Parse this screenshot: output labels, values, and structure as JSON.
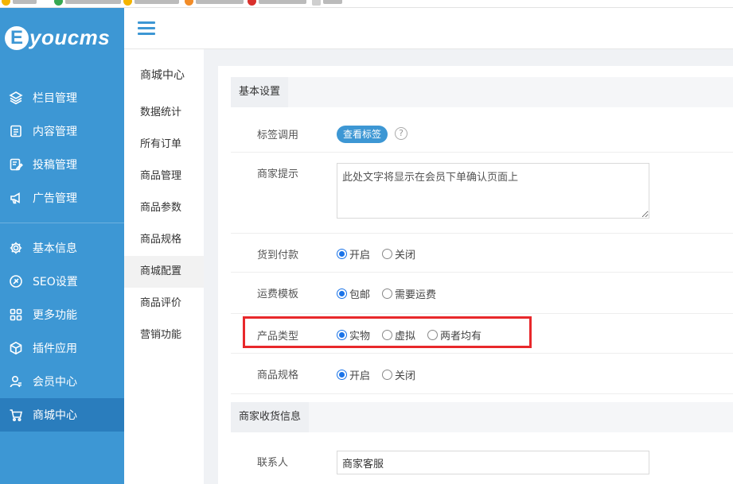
{
  "colors": {
    "sidebar_bg": "#3d97d4",
    "sidebar_active": "#2a7dbd",
    "accent": "#3d97d4",
    "radio_on": "#1a73e8",
    "highlight": "#e8282b"
  },
  "brand": {
    "logo_letter": "E",
    "logo_text": "youcms"
  },
  "sidebar": {
    "items": [
      {
        "label": "栏目管理",
        "icon": "layers-icon"
      },
      {
        "label": "内容管理",
        "icon": "document-icon"
      },
      {
        "label": "投稿管理",
        "icon": "edit-icon"
      },
      {
        "label": "广告管理",
        "icon": "megaphone-icon"
      },
      {
        "label": "基本信息",
        "icon": "gear-icon"
      },
      {
        "label": "SEO设置",
        "icon": "seo-icon"
      },
      {
        "label": "更多功能",
        "icon": "grid-icon"
      },
      {
        "label": "插件应用",
        "icon": "cube-icon"
      },
      {
        "label": "会员中心",
        "icon": "user-icon"
      },
      {
        "label": "商城中心",
        "icon": "cart-icon",
        "active": true
      }
    ]
  },
  "submenu": {
    "title": "商城中心",
    "items": [
      "数据统计",
      "所有订单",
      "商品管理",
      "商品参数",
      "商品规格",
      "商城配置",
      "商品评价",
      "营销功能"
    ],
    "active_index": 5
  },
  "form": {
    "section_basic": "基本设置",
    "tag_label": "标签调用",
    "tag_button": "查看标签",
    "tag_help": "?",
    "merchant_tip_label": "商家提示",
    "merchant_tip_placeholder": "此处文字将显示在会员下单确认页面上",
    "cod_label": "货到付款",
    "cod_options": [
      "开启",
      "关闭"
    ],
    "cod_selected": 0,
    "freight_label": "运费模板",
    "freight_options": [
      "包邮",
      "需要运费"
    ],
    "freight_selected": 0,
    "product_type_label": "产品类型",
    "product_type_options": [
      "实物",
      "虚拟",
      "两者均有"
    ],
    "product_type_selected": 0,
    "spec_label": "商品规格",
    "spec_options": [
      "开启",
      "关闭"
    ],
    "spec_selected": 0,
    "section_receive": "商家收货信息",
    "contact_label": "联系人",
    "contact_value": "商家客服"
  }
}
